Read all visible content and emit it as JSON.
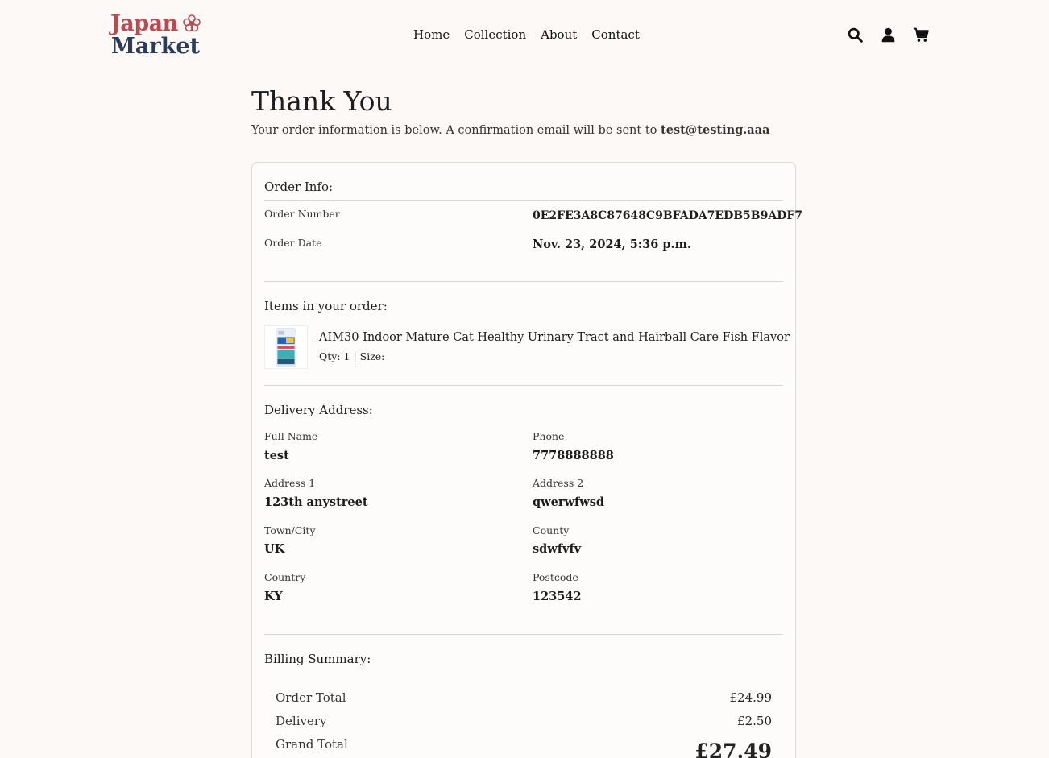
{
  "brand": {
    "line1": "Japan",
    "line2": "Market",
    "color_primary": "#c0474c",
    "color_secondary": "#2a3c5a"
  },
  "nav": {
    "items": [
      {
        "label": "Home"
      },
      {
        "label": "Collection"
      },
      {
        "label": "About"
      },
      {
        "label": "Contact"
      }
    ]
  },
  "header_icons": [
    "search-icon",
    "user-icon",
    "cart-icon"
  ],
  "page": {
    "title": "Thank You",
    "subtitle_text": "Your order information is below. A confirmation email will be sent to ",
    "email": "test@testing.aaa"
  },
  "order_info": {
    "heading": "Order Info:",
    "number_label": "Order Number",
    "number_value": "0E2FE3A8C87648C9BFADA7EDB5B9ADF7",
    "date_label": "Order Date",
    "date_value": "Nov. 23, 2024, 5:36 p.m."
  },
  "items": {
    "heading": "Items in your order:",
    "list": [
      {
        "name": "AIM30 Indoor Mature Cat Healthy Urinary Tract and Hairball Care Fish Flavor",
        "meta": "Qty: 1 | Size:"
      }
    ]
  },
  "delivery": {
    "heading": "Delivery Address:",
    "full_name_label": "Full Name",
    "full_name": "test",
    "phone_label": "Phone",
    "phone": "7778888888",
    "address1_label": "Address 1",
    "address1": "123th anystreet",
    "address2_label": "Address 2",
    "address2": "qwerwfwsd",
    "town_label": "Town/City",
    "town": "UK",
    "county_label": "County",
    "county": "sdwfvfv",
    "country_label": "Country",
    "country": "KY",
    "postcode_label": "Postcode",
    "postcode": "123542"
  },
  "billing": {
    "heading": "Billing Summary:",
    "order_total_label": "Order Total",
    "order_total": "£24.99",
    "delivery_label": "Delivery",
    "delivery": "£2.50",
    "grand_total_label": "Grand Total",
    "grand_total": "£27.49"
  }
}
